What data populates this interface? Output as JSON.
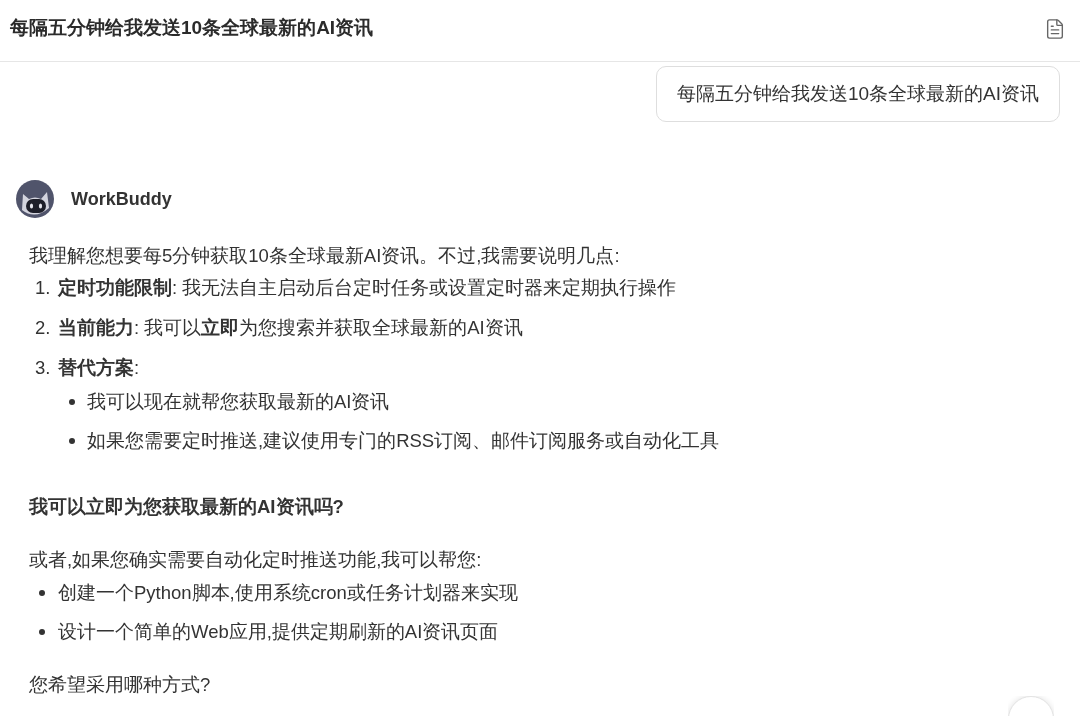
{
  "header": {
    "title": "每隔五分钟给我发送10条全球最新的AI资讯"
  },
  "user_message": {
    "text": "每隔五分钟给我发送10条全球最新的AI资讯"
  },
  "assistant": {
    "name": "WorkBuddy",
    "blocks": [
      {
        "kind": "paragraph",
        "text": "我理解您想要每5分钟获取10条全球最新AI资讯。不过,我需要说明几点:"
      },
      {
        "kind": "numbered_list",
        "items": [
          {
            "number": "1.",
            "text": "**定时功能限制**: 我无法自主启动后台定时任务或设置定时器来定期执行操作"
          },
          {
            "number": "2.",
            "text": "**当前能力**: 我可以**立即**为您搜索并获取全球最新的AI资讯"
          },
          {
            "number": "3.",
            "text": "**替代方案**:",
            "children": [
              {
                "text": "我可以现在就帮您获取最新的AI资讯"
              },
              {
                "text": "如果您需要定时推送,建议使用专门的RSS订阅、邮件订阅服务或自动化工具"
              }
            ]
          }
        ]
      },
      {
        "kind": "emphasis",
        "text": "我可以立即为您获取最新的AI资讯吗?"
      },
      {
        "kind": "paragraph",
        "text": "或者,如果您确实需要自动化定时推送功能,我可以帮您:"
      },
      {
        "kind": "bullet_list",
        "items": [
          {
            "text": "创建一个Python脚本,使用系统cron或任务计划器来实现"
          },
          {
            "text": "设计一个简单的Web应用,提供定期刷新的AI资讯页面"
          }
        ]
      },
      {
        "kind": "paragraph",
        "text": "您希望采用哪种方式?"
      }
    ]
  }
}
